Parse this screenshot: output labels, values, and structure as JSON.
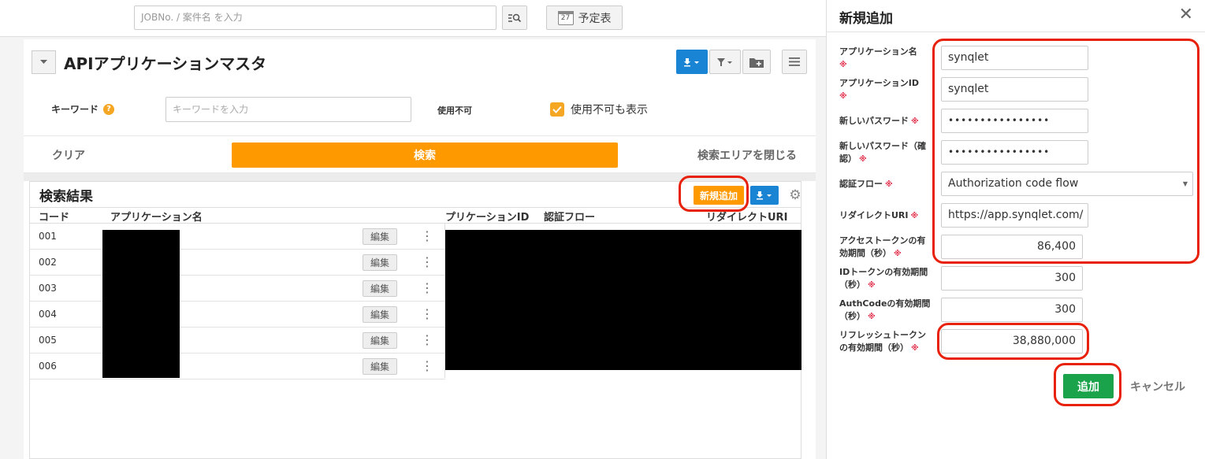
{
  "topbar": {
    "search_placeholder": "JOBNo. / 案件名 を入力",
    "schedule_label": "予定表",
    "calendar_day": "27"
  },
  "page": {
    "title": "APIアプリケーションマスタ"
  },
  "filter": {
    "keyword_label": "キーワード",
    "keyword_placeholder": "キーワードを入力",
    "unavailable_label": "使用不可",
    "show_unavailable_label": "使用不可も表示",
    "show_unavailable_checked": true,
    "clear_label": "クリア",
    "search_label": "検索",
    "close_area_label": "検索エリアを閉じる"
  },
  "results": {
    "title": "検索結果",
    "new_button_label": "新規追加",
    "columns": [
      "コード",
      "アプリケーション名",
      "プリケーションID",
      "認証フロー",
      "リダイレクトURI"
    ],
    "edit_label": "編集",
    "rows": [
      {
        "code": "001"
      },
      {
        "code": "002"
      },
      {
        "code": "003"
      },
      {
        "code": "004"
      },
      {
        "code": "005"
      },
      {
        "code": "006"
      }
    ]
  },
  "panel": {
    "title": "新規追加",
    "required_mark": "※",
    "fields": {
      "app_name": {
        "label": "アプリケーション名",
        "value": "synqlet"
      },
      "app_id": {
        "label": "アプリケーションID",
        "value": "synqlet"
      },
      "new_password": {
        "label": "新しいパスワード",
        "value": "••••••••••••••••"
      },
      "confirm_password": {
        "label": "新しいパスワード（確認）",
        "value": "••••••••••••••••"
      },
      "auth_flow": {
        "label": "認証フロー",
        "value": "Authorization code flow"
      },
      "redirect_uri": {
        "label": "リダイレクトURI",
        "value": "https://app.synqlet.com/"
      },
      "access_token_ttl": {
        "label": "アクセストークンの有効期間（秒）",
        "value": "86,400"
      },
      "id_token_ttl": {
        "label": "IDトークンの有効期間（秒）",
        "value": "300"
      },
      "authcode_ttl": {
        "label": "AuthCodeの有効期間（秒）",
        "value": "300"
      },
      "refresh_token_ttl": {
        "label": "リフレッシュトークンの有効期間（秒）",
        "value": "38,880,000"
      }
    },
    "add_label": "追加",
    "cancel_label": "キャンセル"
  },
  "colors": {
    "accent_orange": "#ff9900",
    "primary_blue": "#1a84d4",
    "success_green": "#1aa34a",
    "annotation_red": "#e8210b",
    "required_pink": "#e2334f"
  }
}
